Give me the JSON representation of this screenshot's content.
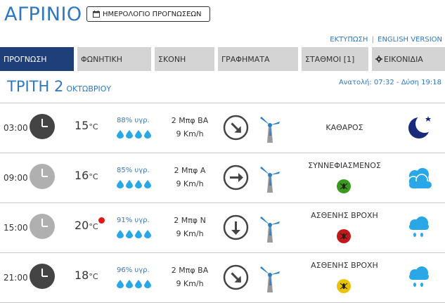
{
  "header": {
    "city": "ΑΓΡΙΝΙΟ",
    "calendar_button": "ΗΜΕΡΟΛΟΓΙΟ ΠΡΟΓΝΩΣΕΩΝ",
    "print_link": "ΕΚΤΥΠΩΣΗ",
    "separator": "|",
    "english_link": "ENGLISH VERSION"
  },
  "tabs": [
    {
      "label": "ΠΡΟΓΝΩΣΗ",
      "active": true
    },
    {
      "label": "ΦΩΝΗΤΙΚΗ",
      "active": false
    },
    {
      "label": "ΣΚΟΝΗ",
      "active": false
    },
    {
      "label": "ΓΡΑΦΗΜΑΤΑ",
      "active": false
    },
    {
      "label": "ΣΤΑΘΜΟΙ [1]",
      "active": false
    },
    {
      "label": "ΕΙΚΟΝΙΔΙΑ",
      "active": false
    }
  ],
  "date": {
    "day": "ΤΡΙΤΗ 2",
    "month": "ΟΚΤΩΒΡΙΟΥ",
    "sun_times": "Ανατολή: 07:32 - Δύση 19:18"
  },
  "forecast": [
    {
      "time": "03:00",
      "temp": "15",
      "unit": "°C",
      "humidity": "88% υγρ.",
      "wind_force": "2 Μπφ ΒΑ",
      "wind_speed": "9 Km/h",
      "condition": "ΚΑΘΑΡΟΣ",
      "clock_color": "#444444",
      "bug": "none",
      "icon": "moon-icon"
    },
    {
      "time": "09:00",
      "temp": "16",
      "unit": "°C",
      "humidity": "85% υγρ.",
      "wind_force": "2 Μπφ Α",
      "wind_speed": "9 Km/h",
      "condition": "ΣΥΝΝΕΦΙΑΣΜΕΝΟΣ",
      "clock_color": "#b0b0b0",
      "bug": "#3a9a1e",
      "icon": "cloudy-icon"
    },
    {
      "time": "15:00",
      "temp": "20",
      "unit": "°C",
      "humidity": "91% υγρ.",
      "wind_force": "2 Μπφ Ν",
      "wind_speed": "9 Km/h",
      "condition": "ΑΣΘΕΝΗΣ ΒΡΟΧΗ",
      "clock_color": "#b0b0b0",
      "bug": "#c41818",
      "icon": "light-rain-icon"
    },
    {
      "time": "21:00",
      "temp": "18",
      "unit": "°C",
      "humidity": "96% υγρ.",
      "wind_force": "2 Μπφ ΒΑ",
      "wind_speed": "9 Km/h",
      "condition": "ΑΣΘΕΝΗΣ ΒΡΟΧΗ",
      "clock_color": "#444444",
      "bug": "#e8c400",
      "icon": "light-rain-icon"
    }
  ],
  "colors": {
    "accent": "#2f78c1",
    "active_tab": "#1f3f7a",
    "tab_bg": "#d4d4d4",
    "icon_blue": "#29a7e6",
    "moon": "#1a2a7a",
    "temp_alert": "#e01818"
  }
}
